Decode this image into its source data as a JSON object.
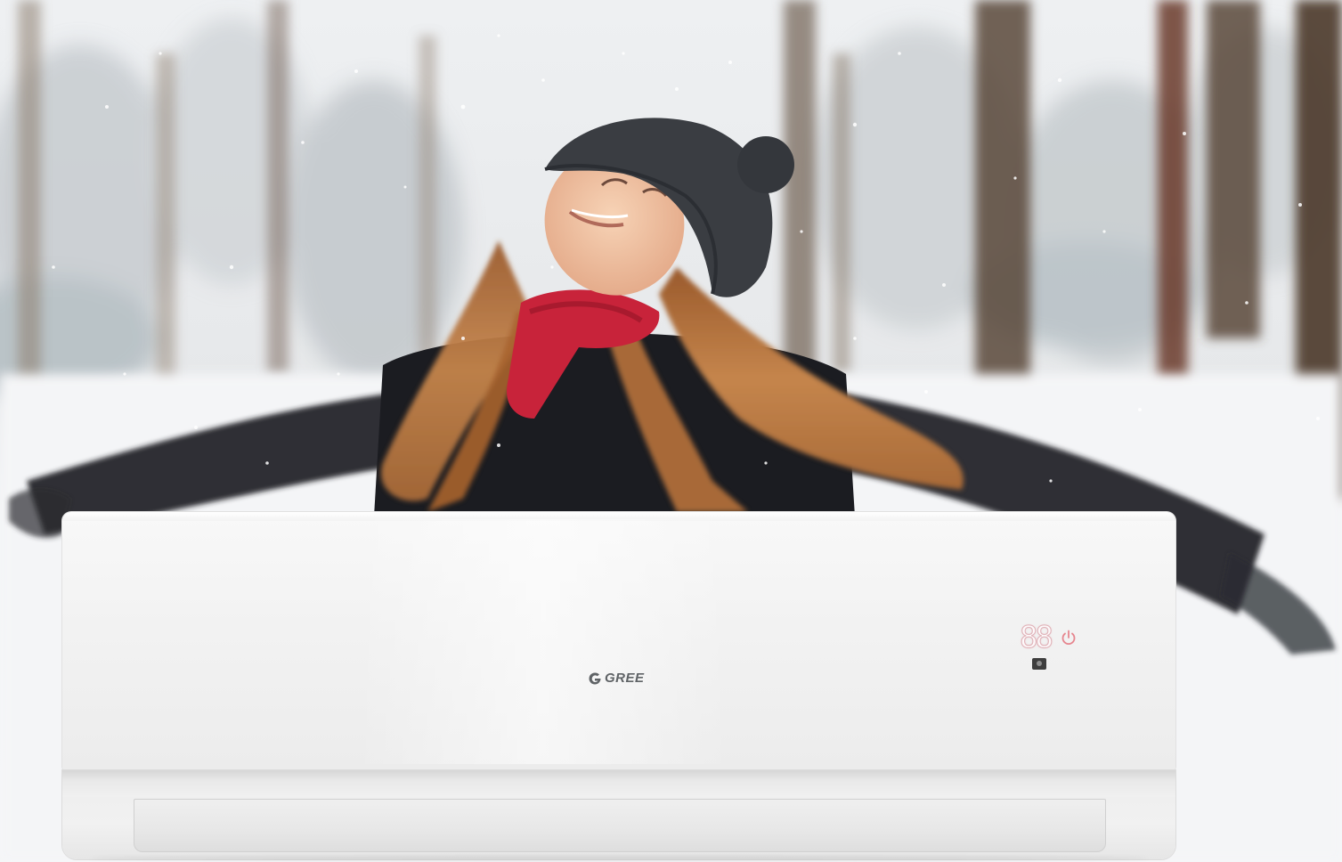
{
  "scene": {
    "description_free": true
  },
  "ac_unit": {
    "brand_logo_text": "GREE",
    "display_digits": "88",
    "power_icon": "power-icon",
    "sensor_icon": "ir-sensor-icon",
    "colors": {
      "panel": "#f2f2f2",
      "logo": "#5f6366",
      "display_glow": "#e0b2b8",
      "power_icon": "#e6868f"
    }
  },
  "background": {
    "colors": {
      "snow": "#f3f4f6",
      "tree_trunk": "#4a3828",
      "coat": "#1e1f24",
      "hat": "#3a3d42",
      "hair": "#b8723c",
      "scarf": "#c8233a",
      "skin": "#f2c4a2"
    }
  }
}
